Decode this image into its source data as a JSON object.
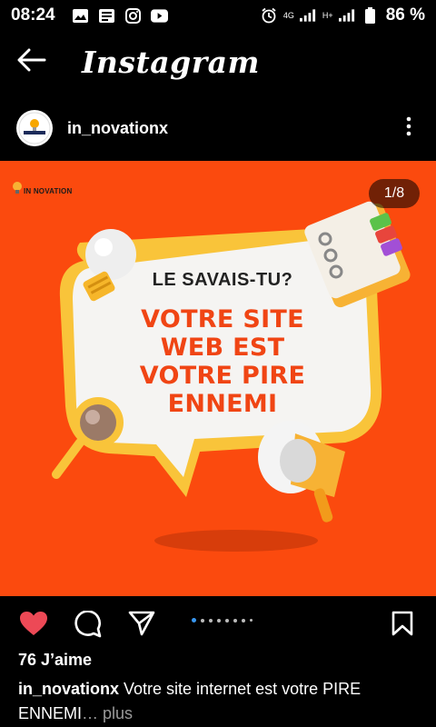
{
  "status_bar": {
    "time": "08:24",
    "network_primary": "4G",
    "network_secondary": "H+",
    "battery": "86 %"
  },
  "header": {
    "title": "Instagram"
  },
  "post": {
    "username": "in_novationx",
    "image": {
      "brand_text": "IN NOVATION",
      "counter": "1/8",
      "kicker": "LE SAVAIS-TU?",
      "headline_line1": "VOTRE SITE",
      "headline_line2": "WEB EST",
      "headline_line3": "VOTRE PIRE",
      "headline_line4": "ENNEMI",
      "background_color": "#fb4a0e",
      "accent_color": "#f04514"
    },
    "carousel": {
      "total": 8,
      "active_index": 1
    },
    "likes": "76 J’aime",
    "caption": {
      "username": "in_novationx",
      "text_line1": " Votre site internet est votre PIRE",
      "text_line2": "ENNEMI",
      "more": "… plus"
    }
  },
  "icons": {
    "back": "arrow-left-icon",
    "more": "vertical-dots-icon",
    "like": "heart-icon",
    "comment": "comment-icon",
    "share": "paper-plane-icon",
    "save": "bookmark-icon"
  }
}
